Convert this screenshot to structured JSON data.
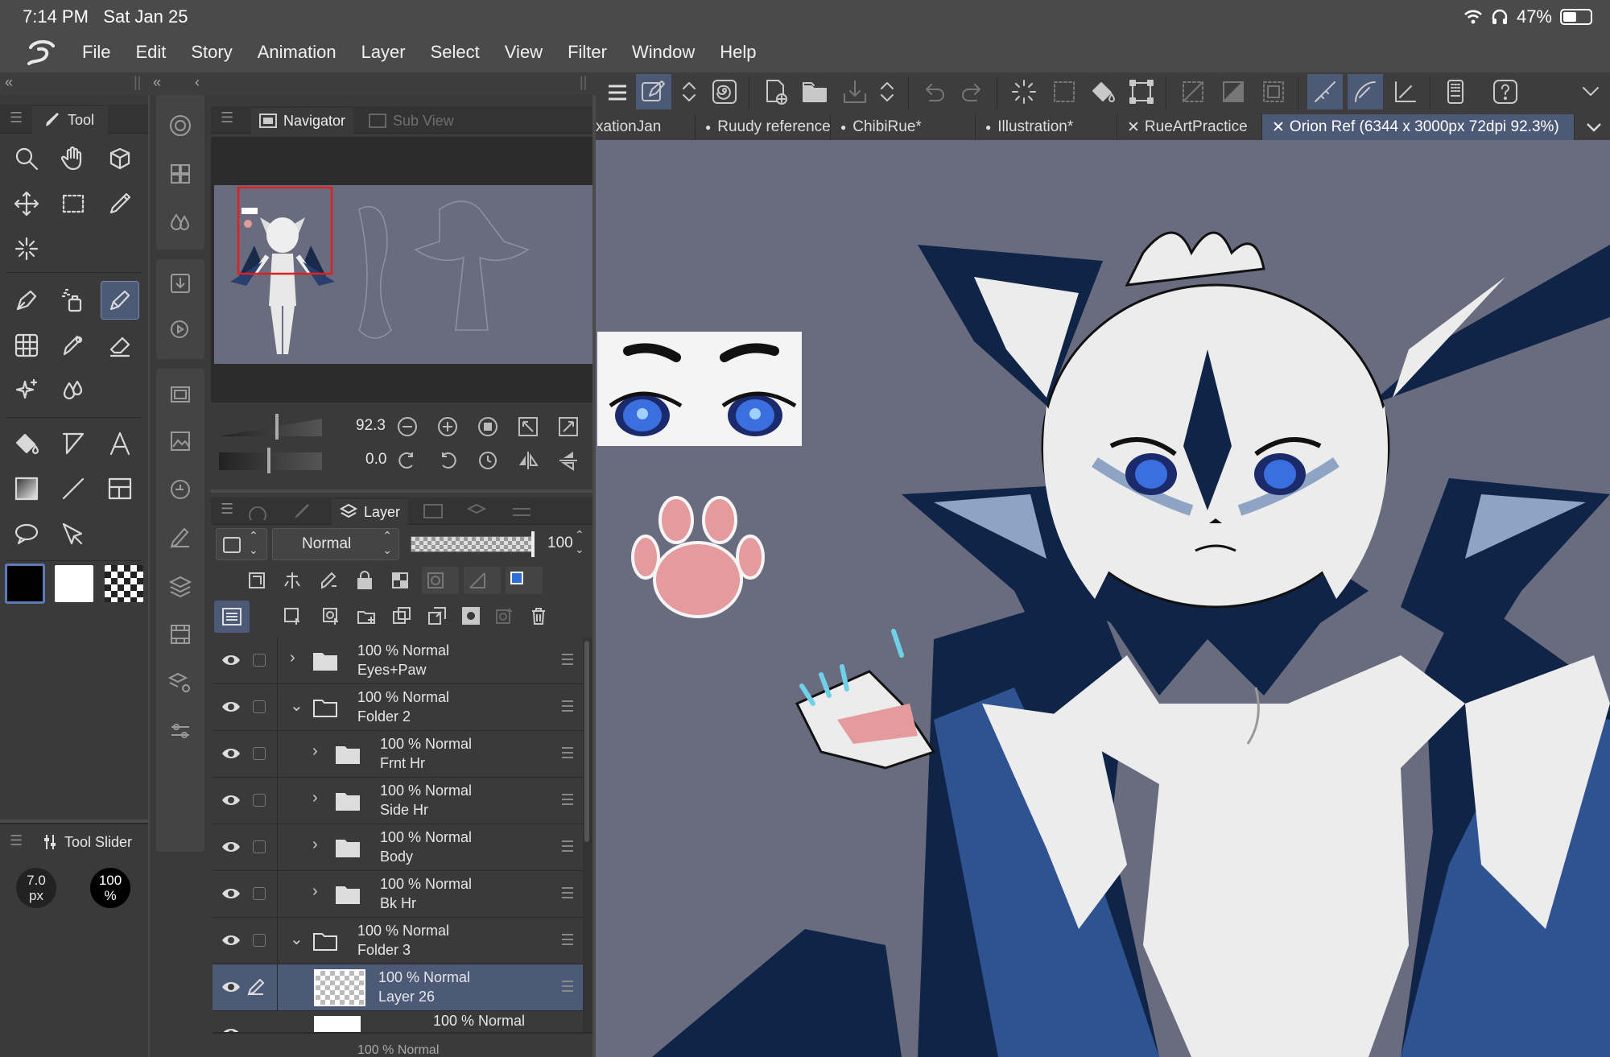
{
  "status": {
    "time": "7:14 PM",
    "date": "Sat Jan 25",
    "battery": "47%"
  },
  "menu": [
    "File",
    "Edit",
    "Story",
    "Animation",
    "Layer",
    "Select",
    "View",
    "Filter",
    "Window",
    "Help"
  ],
  "tool_panel": {
    "tab": "Tool"
  },
  "tool_slider": {
    "tab": "Tool Slider",
    "size_value": "7.0",
    "size_unit": "px",
    "opacity_value": "100",
    "opacity_unit": "%"
  },
  "navigator": {
    "tab": "Navigator",
    "subview_tab": "Sub View",
    "zoom": "92.3",
    "rotation": "0.0"
  },
  "layer_panel": {
    "tab": "Layer",
    "blend_mode": "Normal",
    "opacity": "100"
  },
  "layers": [
    {
      "opacity": "100 %",
      "mode": "Normal",
      "name": "Eyes+Paw",
      "type": "folder",
      "expanded": false,
      "indent": 0
    },
    {
      "opacity": "100 %",
      "mode": "Normal",
      "name": "Folder 2",
      "type": "folder",
      "expanded": true,
      "indent": 0
    },
    {
      "opacity": "100 %",
      "mode": "Normal",
      "name": "Frnt Hr",
      "type": "folder",
      "expanded": false,
      "indent": 1
    },
    {
      "opacity": "100 %",
      "mode": "Normal",
      "name": "Side Hr",
      "type": "folder",
      "expanded": false,
      "indent": 1
    },
    {
      "opacity": "100 %",
      "mode": "Normal",
      "name": "Body",
      "type": "folder",
      "expanded": false,
      "indent": 1
    },
    {
      "opacity": "100 %",
      "mode": "Normal",
      "name": "Bk Hr",
      "type": "folder",
      "expanded": false,
      "indent": 1
    },
    {
      "opacity": "100 %",
      "mode": "Normal",
      "name": "Folder 3",
      "type": "folder",
      "expanded": true,
      "indent": 0
    },
    {
      "opacity": "100 %",
      "mode": "Normal",
      "name": "Layer 26",
      "type": "raster",
      "selected": true,
      "indent": 1
    }
  ],
  "layer_partial": {
    "label1": "100 % Normal",
    "label2": "100 % Normal"
  },
  "doc_tabs": [
    {
      "label": "xationJan",
      "marker": ""
    },
    {
      "label": "Ruudy reference",
      "marker": "●"
    },
    {
      "label": "ChibiRue*",
      "marker": "●"
    },
    {
      "label": "Illustration*",
      "marker": "●"
    },
    {
      "label": "RueArtPractice",
      "marker": "✕"
    },
    {
      "label": "Orion Ref (6344 x 3000px 72dpi 92.3%)",
      "marker": "✕",
      "active": true
    }
  ],
  "colors": {
    "accent": "#4c5a78",
    "canvas_bg": "#696c7e",
    "panel": "#3a3a3a",
    "art_navy": "#0f2447",
    "art_blue": "#2f5290",
    "art_light_blue": "#8fa4c4",
    "art_white": "#ececec",
    "paw_pink": "#e59a9d"
  }
}
